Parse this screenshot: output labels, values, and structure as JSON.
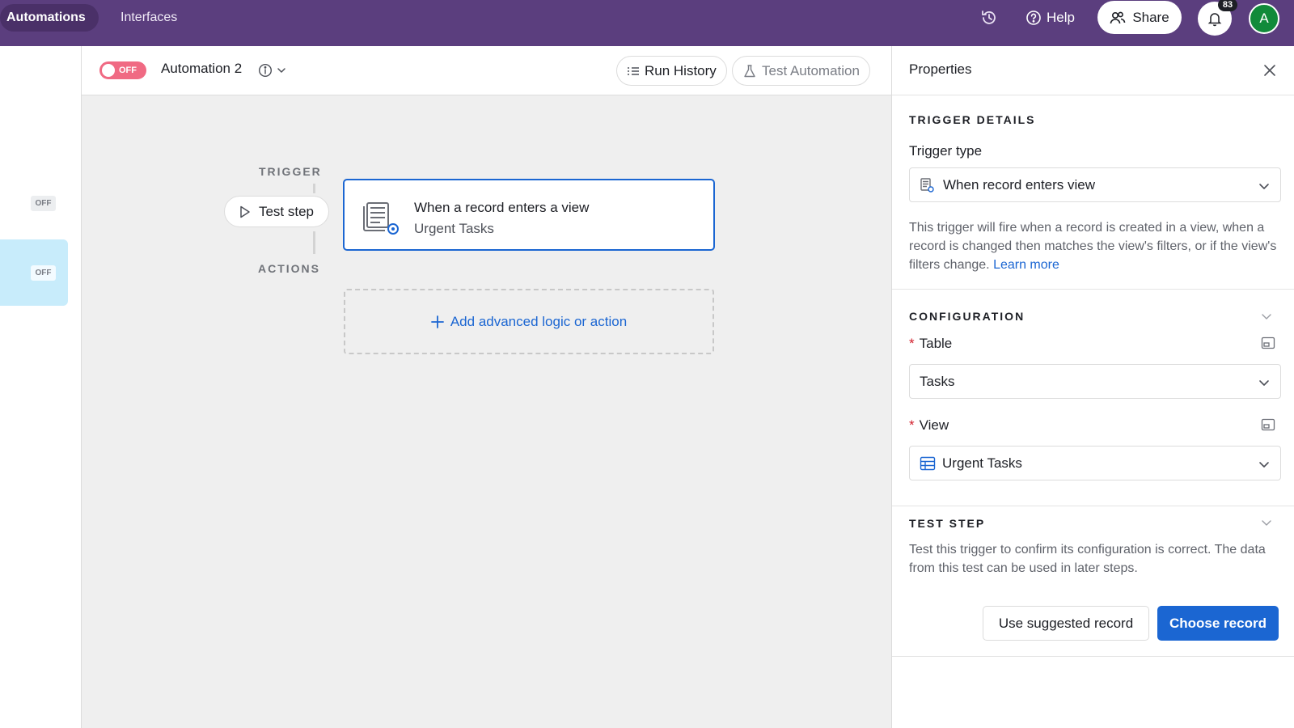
{
  "topbar": {
    "tabs": [
      {
        "label": "Automations",
        "active": true
      },
      {
        "label": "Interfaces",
        "active": false
      }
    ],
    "help_label": "Help",
    "share_label": "Share",
    "notification_count": "83",
    "avatar_initial": "A",
    "brand_color": "#5b3e7e"
  },
  "sidebar": {
    "items": [
      {
        "status": "OFF"
      },
      {
        "status": "OFF",
        "selected": true
      }
    ]
  },
  "header": {
    "toggle_label": "OFF",
    "automation_name": "Automation 2",
    "run_history_label": "Run History",
    "test_automation_label": "Test Automation"
  },
  "canvas": {
    "trigger_label": "TRIGGER",
    "actions_label": "ACTIONS",
    "test_step_label": "Test step",
    "trigger_card": {
      "title": "When a record enters a view",
      "subtitle": "Urgent Tasks"
    },
    "add_action_label": "Add advanced logic or action"
  },
  "panel": {
    "title": "Properties",
    "trigger_details": {
      "section_title": "TRIGGER DETAILS",
      "trigger_type_label": "Trigger type",
      "trigger_type_value": "When record enters view",
      "description": "This trigger will fire when a record is created in a view, when a record is changed then matches the view's filters, or if the view's filters change.",
      "learn_more": "Learn more"
    },
    "configuration": {
      "section_title": "CONFIGURATION",
      "table_label": "Table",
      "table_value": "Tasks",
      "view_label": "View",
      "view_value": "Urgent Tasks",
      "required_marker": "*"
    },
    "test_step": {
      "section_title": "TEST STEP",
      "description": "Test this trigger to confirm its configuration is correct. The data from this test can be used in later steps.",
      "secondary_button": "Use suggested record",
      "primary_button": "Choose record"
    }
  }
}
